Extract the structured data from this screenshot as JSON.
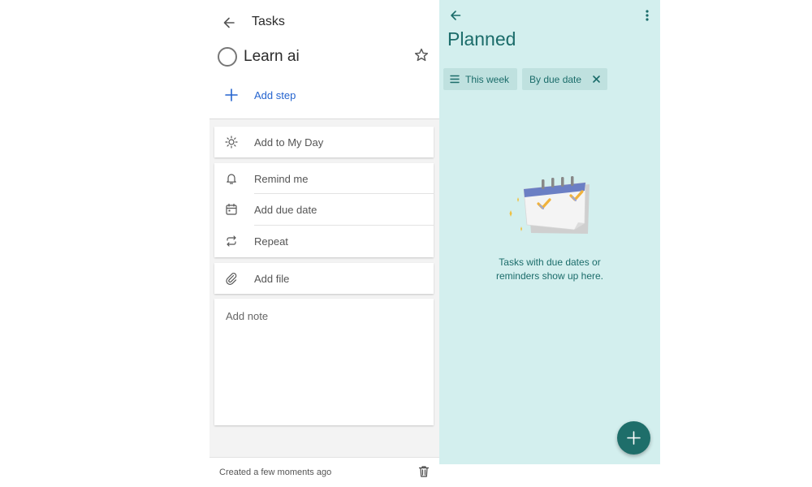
{
  "task_detail": {
    "header_title": "Tasks",
    "task_title": "Learn ai",
    "add_step_label": "Add step",
    "my_day_label": "Add to My Day",
    "remind_label": "Remind me",
    "due_date_label": "Add due date",
    "repeat_label": "Repeat",
    "file_label": "Add file",
    "note_placeholder": "Add note",
    "created_text": "Created a few moments ago"
  },
  "planned_list": {
    "title": "Planned",
    "filter_chip_label": "This week",
    "sort_chip_label": "By due date",
    "empty_message_line1": "Tasks with due dates or",
    "empty_message_line2": "reminders show up here."
  },
  "icons": [
    "back-arrow-icon",
    "star-icon",
    "plus-icon",
    "sun-icon",
    "bell-icon",
    "calendar-icon",
    "repeat-icon",
    "paperclip-icon",
    "trash-icon",
    "more-vertical-icon",
    "filter-lines-icon",
    "close-icon"
  ],
  "colors": {
    "accent_blue": "#2564cf",
    "planned_teal": "#1b6c6a",
    "planned_bg": "#d3efee",
    "fab": "#1e6e6a"
  }
}
